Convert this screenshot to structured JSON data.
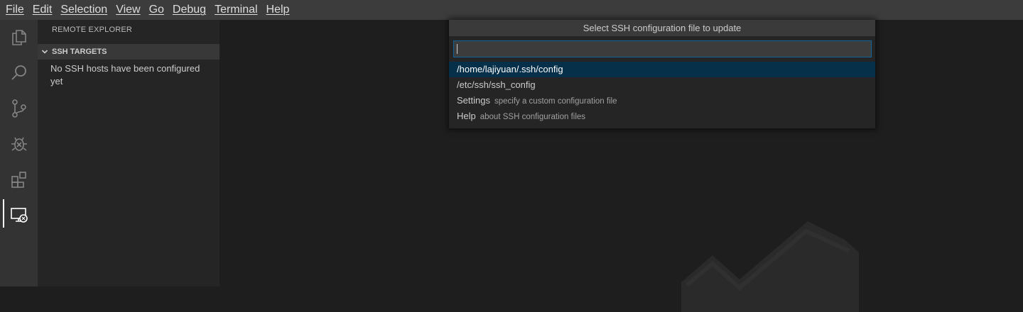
{
  "menubar": {
    "items": [
      "File",
      "Edit",
      "Selection",
      "View",
      "Go",
      "Debug",
      "Terminal",
      "Help"
    ]
  },
  "activitybar": {
    "items": [
      "files-icon",
      "search-icon",
      "source-control-icon",
      "debug-icon",
      "extensions-icon",
      "remote-explorer-icon"
    ],
    "active": "remote-explorer-icon"
  },
  "sidebar": {
    "title": "REMOTE EXPLORER",
    "section": "SSH TARGETS",
    "empty_message": "No SSH hosts have been configured yet"
  },
  "quickpick": {
    "title": "Select SSH configuration file to update",
    "input_value": "",
    "items": [
      {
        "label": "/home/lajiyuan/.ssh/config",
        "description": "",
        "selected": true
      },
      {
        "label": "/etc/ssh/ssh_config",
        "description": "",
        "selected": false
      },
      {
        "label": "Settings",
        "description": "specify a custom configuration file",
        "selected": false
      },
      {
        "label": "Help",
        "description": "about SSH configuration files",
        "selected": false
      }
    ]
  },
  "colors": {
    "menubar_bg": "#3c3c3c",
    "activitybar_bg": "#333333",
    "sidebar_bg": "#252526",
    "editor_bg": "#1e1e1e",
    "selection_bg": "#062f4a",
    "focus_border": "#0e639c"
  }
}
